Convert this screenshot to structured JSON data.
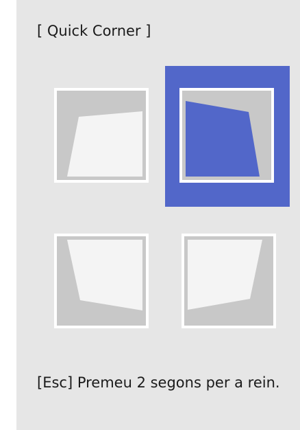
{
  "dialog": {
    "title": "[ Quick Corner ]",
    "footer_hint": "[Esc] Premeu 2 segons per a rein."
  },
  "corners": [
    {
      "name": "top-left",
      "selected": false
    },
    {
      "name": "top-right",
      "selected": true
    },
    {
      "name": "bottom-left",
      "selected": false
    },
    {
      "name": "bottom-right",
      "selected": false
    }
  ],
  "colors": {
    "panel_background": "#e6e6e6",
    "selection": "#5267c9",
    "frame": "#c8c8c8",
    "screen_fill": "#f4f4f4",
    "text": "#1a1a1a"
  }
}
